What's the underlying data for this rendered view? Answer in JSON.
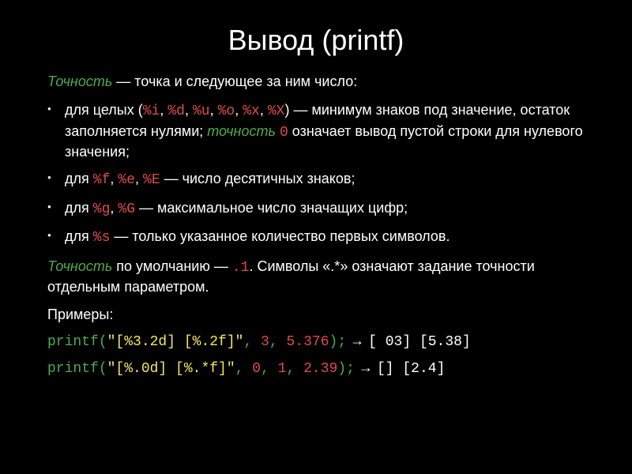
{
  "title": "Вывод (printf)",
  "lead": {
    "precision_word": "Точность",
    "rest": " — точка и следующее за ним число:"
  },
  "bullets": {
    "b1": {
      "t1": "для целых (",
      "s1": "%i",
      "c1": ", ",
      "s2": "%d",
      "c2": ", ",
      "s3": "%u",
      "c3": ", ",
      "s4": "%o",
      "c4": ", ",
      "s5": "%x",
      "c5": ", ",
      "s6": "%X",
      "t2": ") — минимум знаков под значение, остаток заполняется нулями; ",
      "prec_word": "точность",
      "sp1": " ",
      "zero": "0",
      "t3": " означает вывод пустой строки для нулевого значения;"
    },
    "b2": {
      "t1": "для ",
      "s1": "%f",
      "c1": ", ",
      "s2": "%e",
      "c2": ", ",
      "s3": "%E",
      "t2": " — число десятичных знаков;"
    },
    "b3": {
      "t1": "для ",
      "s1": "%g",
      "c1": ", ",
      "s2": "%G",
      "t2": " — максимальное число значащих цифр;"
    },
    "b4": {
      "t1": "для ",
      "s1": "%s",
      "t2": " — только указанное количество первых символов."
    }
  },
  "note": {
    "precision_word": "Точность",
    "t1": " по умолчанию — ",
    "dot1": ".1",
    "t2": ". Символы «.*» означают задание точности отдельным параметром."
  },
  "examples_label": "Примеры:",
  "ex1": {
    "fn": "printf",
    "p1": "(",
    "str": "\"[%3.2d] [%.2f]\"",
    "c1": ", ",
    "n1": "3",
    "c2": ", ",
    "n2": "5.376",
    "p2": ")",
    "semi": ";",
    "arrow": " → ",
    "out": "[ 03] [5.38]"
  },
  "ex2": {
    "fn": "printf",
    "p1": "(",
    "str": "\"[%.0d] [%.*f]\"",
    "c1": ", ",
    "n1": "0",
    "c2": ", ",
    "n2": "1",
    "c3": ", ",
    "n3": "2.39",
    "p2": ")",
    "semi": ";",
    "arrow": " → ",
    "out": " [] [2.4]"
  }
}
